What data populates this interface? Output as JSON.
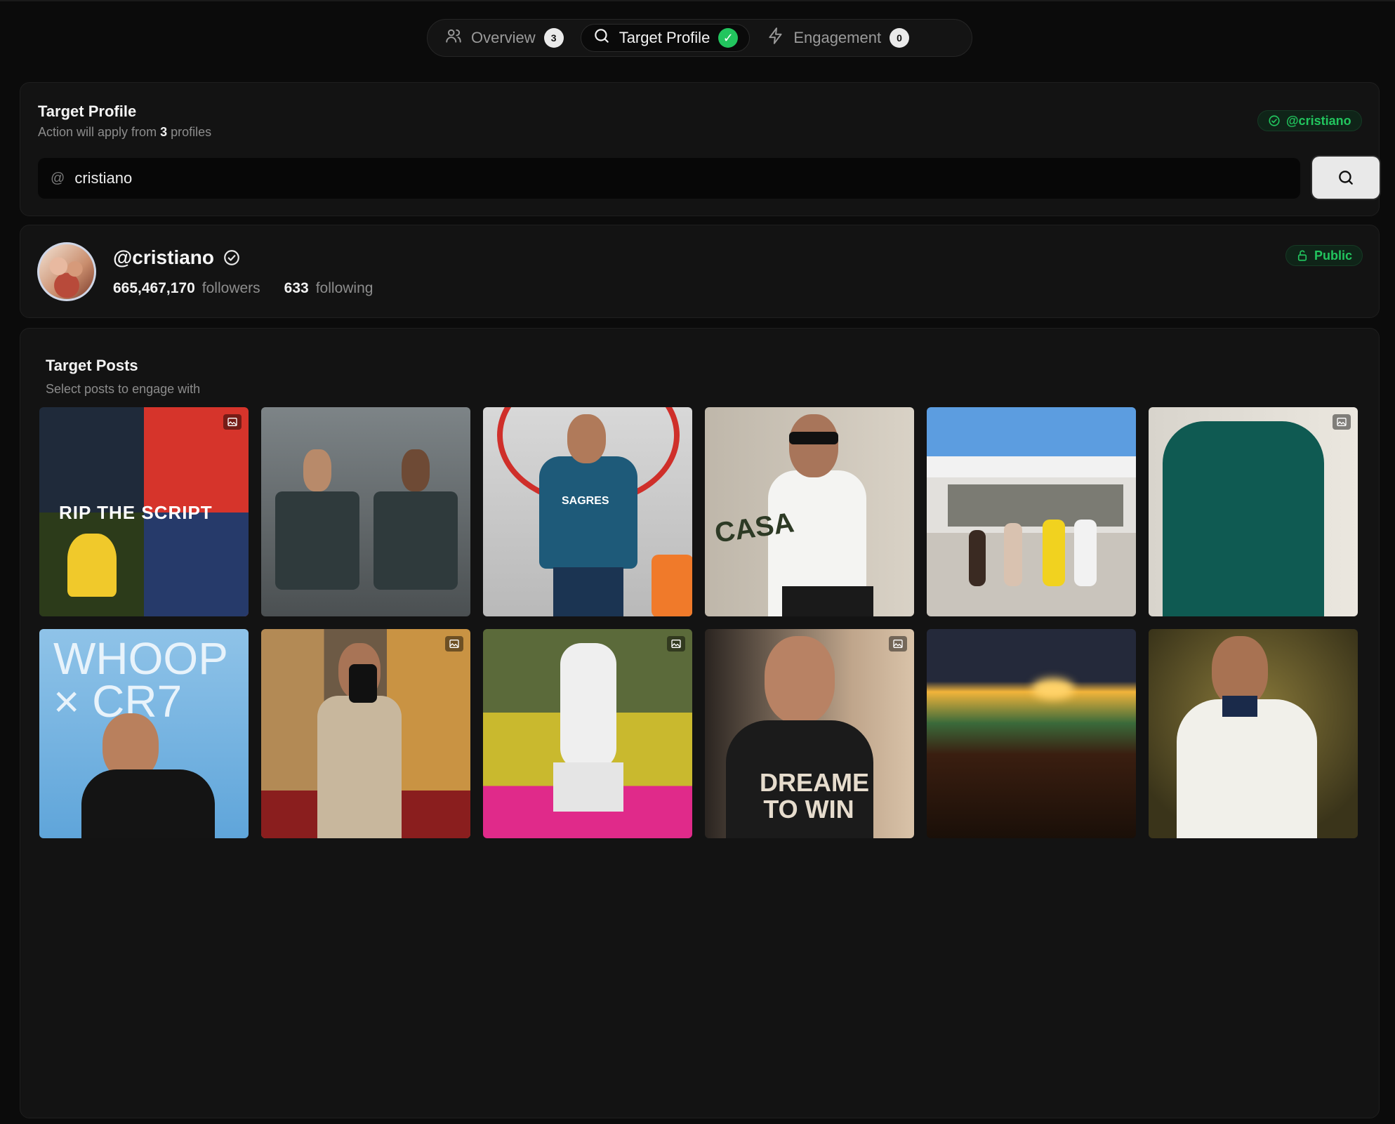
{
  "tabs": [
    {
      "label": "Overview",
      "badge": "3",
      "icon": "users-icon"
    },
    {
      "label": "Target Profile",
      "badge": "✓",
      "icon": "search-icon"
    },
    {
      "label": "Engagement",
      "badge": "0",
      "icon": "bolt-icon"
    }
  ],
  "target": {
    "title": "Target Profile",
    "subtitle_prefix": "Action will apply from ",
    "subtitle_count": "3",
    "subtitle_suffix": " profiles",
    "verified_handle": "@cristiano",
    "input_prefix": "@",
    "input_value": "cristiano"
  },
  "profile": {
    "username": "@cristiano",
    "followers": "665,467,170",
    "followers_label": "followers",
    "following": "633",
    "following_label": "following",
    "visibility": "Public"
  },
  "posts_section": {
    "title": "Target Posts",
    "subtitle": "Select posts to engage with",
    "posts": [
      {
        "caption": "RIP THE SCRIPT",
        "gallery": true
      },
      {
        "caption": "",
        "gallery": false
      },
      {
        "caption": "SAGRES",
        "gallery": false
      },
      {
        "caption": "CASA",
        "gallery": false
      },
      {
        "caption": "",
        "gallery": false
      },
      {
        "caption": "",
        "gallery": true
      },
      {
        "caption": "WHOOP × CR7",
        "gallery": false
      },
      {
        "caption": "",
        "gallery": true
      },
      {
        "caption": "",
        "gallery": true
      },
      {
        "caption": "DREAME TO WIN",
        "gallery": true
      },
      {
        "caption": "",
        "gallery": false
      },
      {
        "caption": "",
        "gallery": false
      }
    ]
  },
  "colors": {
    "accent_green": "#22c55e",
    "background": "#0b0b0b",
    "card": "#131313"
  }
}
